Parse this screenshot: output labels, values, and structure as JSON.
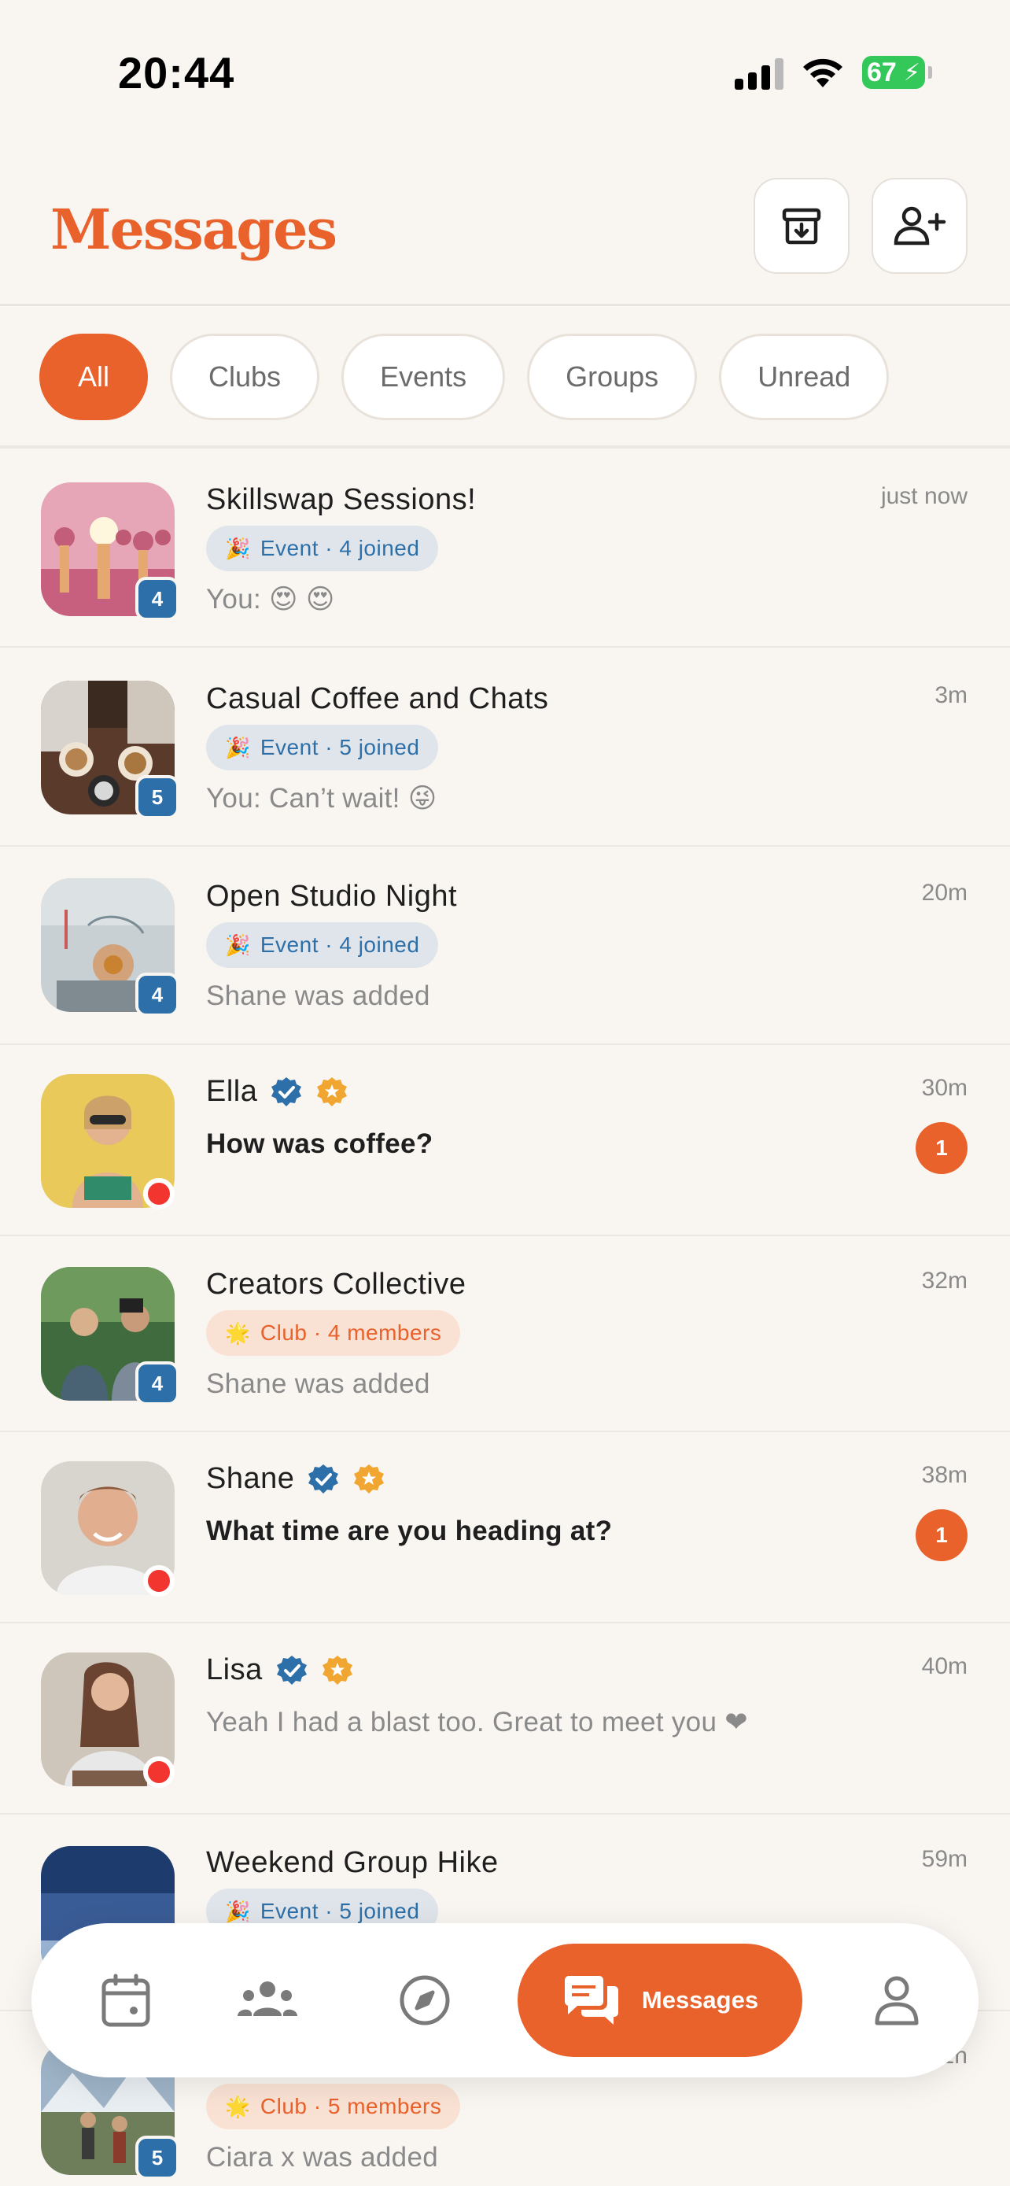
{
  "status_bar": {
    "time": "20:44",
    "battery": "67"
  },
  "header": {
    "title": "Messages",
    "archive_icon": "archive-icon",
    "add_user_icon": "add-user-icon"
  },
  "filters": [
    {
      "label": "All",
      "active": true
    },
    {
      "label": "Clubs",
      "active": false
    },
    {
      "label": "Events",
      "active": false
    },
    {
      "label": "Groups",
      "active": false
    },
    {
      "label": "Unread",
      "active": false
    }
  ],
  "conversations": [
    {
      "name": "Skillswap Sessions!",
      "time": "just now",
      "tag": "Event · 4 joined",
      "tag_type": "event",
      "preview": "You: 😍 😍",
      "count": "4"
    },
    {
      "name": "Casual Coffee and Chats",
      "time": "3m",
      "tag": "Event · 5 joined",
      "tag_type": "event",
      "preview": "You: Can’t wait! 😜",
      "count": "5"
    },
    {
      "name": "Open Studio Night",
      "time": "20m",
      "tag": "Event · 4 joined",
      "tag_type": "event",
      "preview": "Shane was added",
      "count": "4"
    },
    {
      "name": "Ella",
      "time": "30m",
      "preview": "How was coffee?",
      "unread": "1",
      "verified": true
    },
    {
      "name": "Creators Collective",
      "time": "32m",
      "tag": "Club · 4 members",
      "tag_type": "club",
      "preview": "Shane was added",
      "count": "4"
    },
    {
      "name": "Shane",
      "time": "38m",
      "preview": "What time are you heading at?",
      "unread": "1",
      "verified": true
    },
    {
      "name": "Lisa",
      "time": "40m",
      "preview": "Yeah I had a blast too. Great to meet you ❤",
      "verified": true
    },
    {
      "name": "Weekend Group Hike",
      "time": "59m",
      "tag": "Event · 5 joined",
      "tag_type": "event"
    },
    {
      "time": "1h",
      "tag": "Club · 5 members",
      "tag_type": "club",
      "preview": "Ciara x was added",
      "count": "5"
    }
  ],
  "tab_bar": {
    "active_label": "Messages",
    "icons": [
      "calendar-icon",
      "community-icon",
      "compass-icon",
      "chat-icon",
      "profile-icon"
    ]
  },
  "colors": {
    "brand": "#E9612B",
    "event_blue": "#2D6FA8",
    "background": "#F9F6F2",
    "online_red": "#F2362F",
    "verified_blue": "#2D6FA8",
    "star_gold": "#F0A631"
  }
}
